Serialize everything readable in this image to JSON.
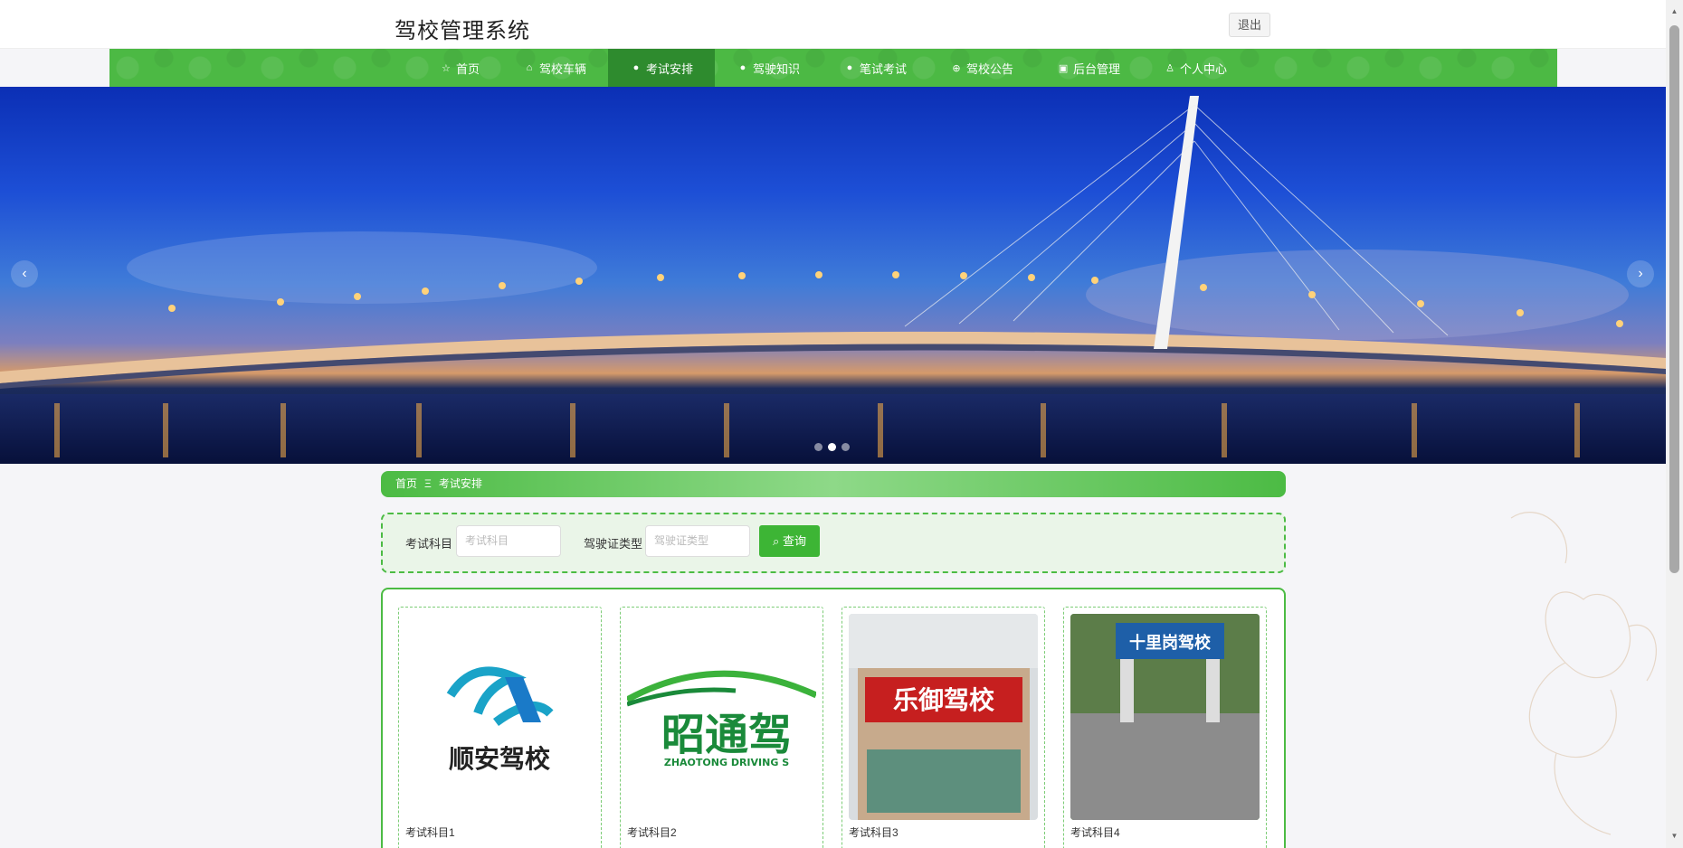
{
  "header": {
    "title": "驾校管理系统",
    "logout_label": "退出"
  },
  "nav": [
    {
      "label": "首页",
      "icon": "star-icon",
      "glyph": "☆"
    },
    {
      "label": "驾校车辆",
      "icon": "home-icon",
      "glyph": "⌂"
    },
    {
      "label": "考试安排",
      "icon": "info-icon",
      "glyph": "●"
    },
    {
      "label": "驾驶知识",
      "icon": "help-icon",
      "glyph": "●"
    },
    {
      "label": "笔试考试",
      "icon": "info-icon",
      "glyph": "●"
    },
    {
      "label": "驾校公告",
      "icon": "globe-icon",
      "glyph": "⊕"
    },
    {
      "label": "后台管理",
      "icon": "dashboard-icon",
      "glyph": "▣"
    },
    {
      "label": "个人中心",
      "icon": "user-icon",
      "glyph": "♙"
    }
  ],
  "nav_active_index": 2,
  "carousel": {
    "prev": "‹",
    "next": "›",
    "slide_count": 3,
    "active_slide": 2
  },
  "breadcrumb": {
    "home": "首页",
    "separator": "Ξ",
    "current": "考试安排"
  },
  "search": {
    "subject_label": "考试科目",
    "subject_placeholder": "考试科目",
    "license_label": "驾驶证类型",
    "license_placeholder": "驾驶证类型",
    "button_label": "查询"
  },
  "cards": [
    {
      "title": "考试科目1",
      "logo_text": "顺安驾校"
    },
    {
      "title": "考试科目2",
      "logo_text": "昭通驾",
      "logo_sub": "ZHAOTONG DRIVING S"
    },
    {
      "title": "考试科目3",
      "logo_text": "乐御驾校"
    },
    {
      "title": "考试科目4",
      "logo_text": "十里岗驾校"
    }
  ],
  "colors": {
    "primary_green": "#4cbb44",
    "nav_active": "#2e8b2e",
    "button_green": "#3db535"
  }
}
